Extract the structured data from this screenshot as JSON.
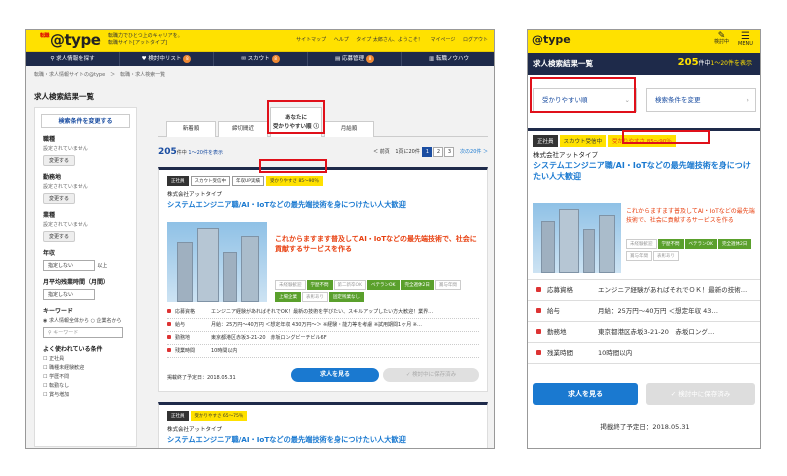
{
  "pc": {
    "logo_prefix": "転職",
    "logo": "@type",
    "tagline_1": "転職力でひとつ上のキャリアを。",
    "tagline_2": "転職サイト[アットタイプ]",
    "top_links": [
      "サイトマップ",
      "ヘルプ",
      "タイプ 太郎さん、ようこそ！",
      "マイページ",
      "ログアウト"
    ],
    "nav": [
      {
        "label": "求人情報を探す"
      },
      {
        "label": "検討中リスト",
        "badge": "8"
      },
      {
        "label": "スカウト",
        "badge": "8"
      },
      {
        "label": "応募管理",
        "badge": "8"
      },
      {
        "label": "転職ノウハウ"
      }
    ],
    "breadcrumb": "転職・求人情報サイトの@type　＞　転職・求人検索一覧",
    "page_title": "求人検索結果一覧",
    "sidebar": {
      "header": "検索条件を変更する",
      "sections": [
        {
          "title": "職種",
          "value": "設定されていません",
          "button": "変更する"
        },
        {
          "title": "勤務地",
          "value": "設定されていません",
          "button": "変更する"
        },
        {
          "title": "業種",
          "value": "設定されていません",
          "button": "変更する"
        },
        {
          "title": "年収",
          "select": "指定しない",
          "suffix": "以上"
        },
        {
          "title": "月平均残業時間（月間）",
          "select": "指定しない"
        }
      ],
      "keyword": {
        "title": "キーワード",
        "radio1": "求人情報全体から",
        "radio2": "企業名から",
        "placeholder": "キーワード"
      },
      "popular": {
        "title": "よく使われている条件",
        "items": [
          "正社員",
          "職種未経験歓迎",
          "学歴不問",
          "転勤なし",
          "賞与増加"
        ]
      }
    },
    "tabs": [
      "新着順",
      "締切間近",
      "あなたにかりやすい順",
      "月給順"
    ],
    "tab_active_1": "あなたに",
    "tab_active_2": "受かりやすい順",
    "count": "205",
    "count_unit": "件中",
    "count_range": "1〜20件を表示",
    "pager": {
      "prev": "＜ 前頁",
      "per": "1頁に20件",
      "pages": [
        "1",
        "2",
        "3"
      ],
      "next": "次の20件 ＞"
    },
    "card": {
      "chips": [
        "正社員",
        "スカウト受信中",
        "年収UP実績",
        "受かりやすさ 85〜90％"
      ],
      "company": "株式会社アットタイプ",
      "title": "システムエンジニア職/AI・IoTなどの最先端技術を身につけたい人大歓迎",
      "catch": "これからますます普及してAI・IoTなどの最先端技術で、社会に貢献するサービスを作る",
      "tags": [
        "未経験歓迎",
        "学歴不問",
        "第二新卒OK",
        "ベテランOK",
        "完全週休2日",
        "賞与年間",
        "上場企業",
        "表彰あり",
        "固定残業なし"
      ],
      "tags_on": [
        false,
        true,
        false,
        true,
        true,
        false,
        true,
        false,
        true
      ],
      "details": [
        {
          "k": "応募資格",
          "v": "エンジニア経験があればそれでOK！最新の技術を学びたい、スキルアップしたい方大歓迎！業界…"
        },
        {
          "k": "給与",
          "v": "月給：25万円〜40万円 ＜想定年収 430万円〜＞ ※経験・能力等を考慮 ※試用期間1ヶ月 ※…"
        },
        {
          "k": "勤務地",
          "v": "東京都港区赤坂3-21-20　赤坂ロングビーチビル6F"
        },
        {
          "k": "残業時間",
          "v": "10時間以内"
        }
      ],
      "ends": "掲載終了予定日：2018.05.31",
      "btn_view": "求人を見る",
      "btn_save": "検討中に保存済み"
    },
    "card2": {
      "chips": [
        "正社員",
        "受かりやすさ 65〜75％"
      ],
      "company": "株式会社アットタイプ",
      "title": "システムエンジニア職/AI・IoTなどの最先端技術を身につけたい人大歓迎"
    }
  },
  "sp": {
    "logo": "@type",
    "icon_fav": "検討中",
    "icon_menu": "MENU",
    "title": "求人検索結果一覧",
    "count": "205",
    "count_unit": "件中",
    "count_range": "1〜20件を表示",
    "sort_select": "受かりやすい順",
    "change_button": "検索条件を変更",
    "card": {
      "chips": [
        "正社員",
        "スカウト受信中",
        "受かりやすさ 85〜90％"
      ],
      "company": "株式会社アットタイプ",
      "title": "システムエンジニア職/AI・IoTなどの最先端技術を身につけたい人大歓迎",
      "catch": "これからますます普及してAI・IoTなどの最先端技術で、社会に貢献するサービスを作る",
      "tags": [
        "未経験歓迎",
        "学歴不問",
        "ベテランOK",
        "完全週休2日",
        "賞与年間",
        "表彰あり"
      ],
      "tags_on": [
        false,
        true,
        true,
        true,
        false,
        false
      ],
      "details": [
        {
          "k": "応募資格",
          "v": "エンジニア経験があればそれでＯＫ！最新の技術…"
        },
        {
          "k": "給与",
          "v": "月給：25万円〜40万円 ＜想定年収 43…"
        },
        {
          "k": "勤務地",
          "v": "東京都港区赤坂3-21-20　赤坂ロング…"
        },
        {
          "k": "残業時間",
          "v": "10時間以内"
        }
      ],
      "btn_view": "求人を見る",
      "btn_save": "検討中に保存済み",
      "ends": "掲載終了予定日：2018.05.31"
    }
  }
}
